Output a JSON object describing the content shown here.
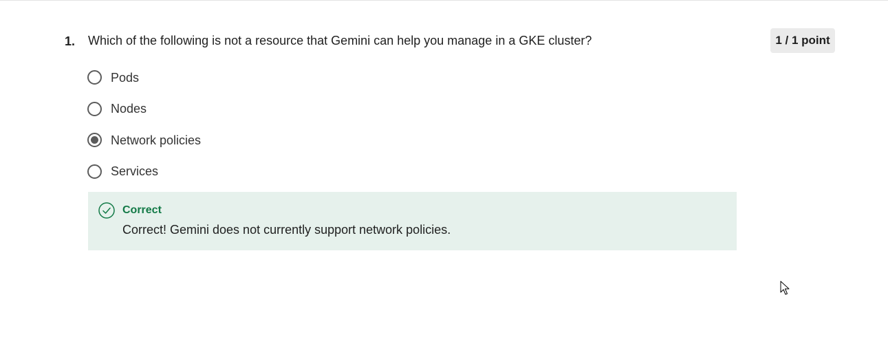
{
  "question": {
    "number": "1.",
    "text": "Which of the following is not a resource that Gemini can help you manage in a GKE cluster?",
    "points": "1 / 1 point",
    "options": [
      {
        "label": "Pods",
        "selected": false
      },
      {
        "label": "Nodes",
        "selected": false
      },
      {
        "label": "Network policies",
        "selected": true
      },
      {
        "label": "Services",
        "selected": false
      }
    ]
  },
  "feedback": {
    "icon": "check-circle-icon",
    "title": "Correct",
    "text": "Correct! Gemini does not currently support network policies."
  },
  "colors": {
    "feedback_background": "#e6f1ec",
    "feedback_accent": "#137a47",
    "badge_background": "#ebebeb",
    "radio": "#5b5b5b"
  }
}
